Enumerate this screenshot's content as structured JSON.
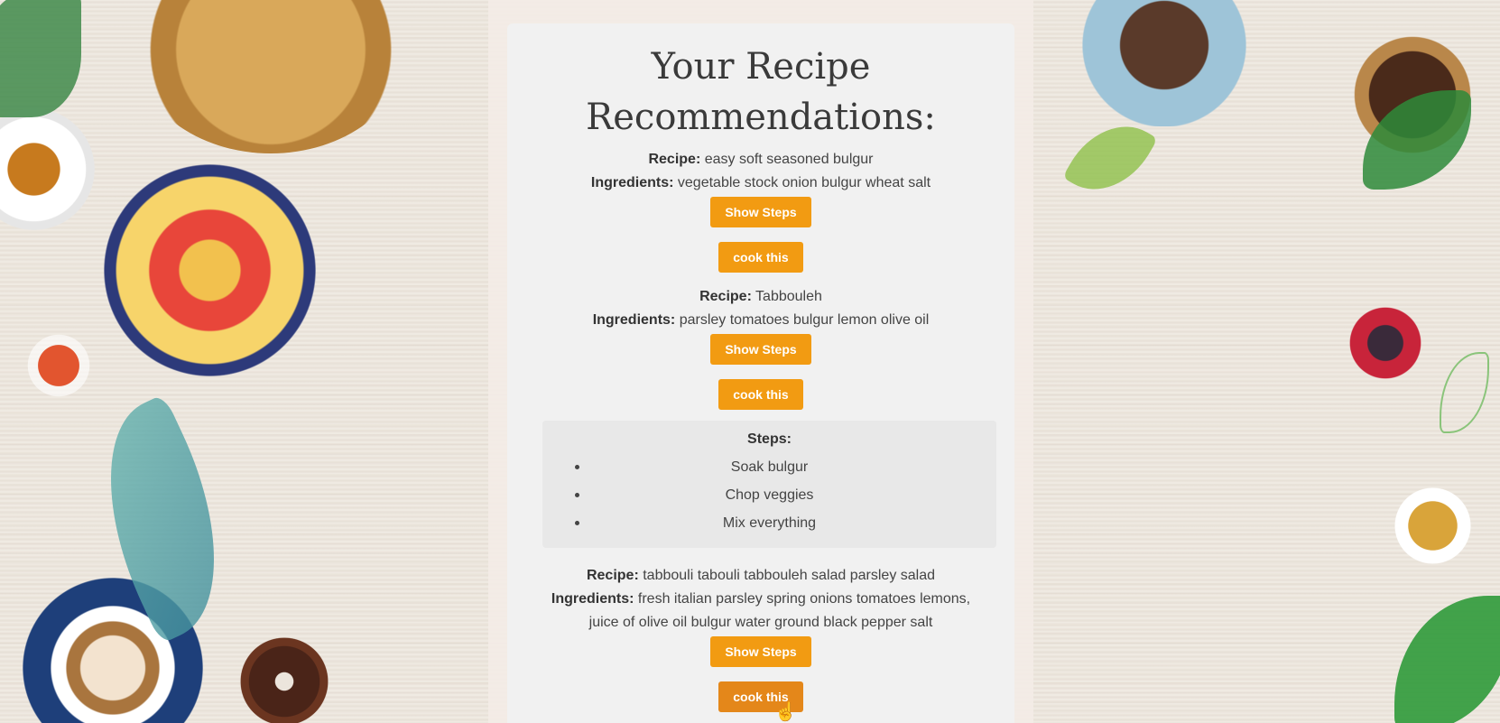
{
  "page": {
    "title": "Your Recipe Recommendations:"
  },
  "labels": {
    "recipe": "Recipe:",
    "ingredients": "Ingredients:",
    "show_steps": "Show Steps",
    "cook_this": "cook this",
    "steps": "Steps:"
  },
  "recipes": [
    {
      "name": "easy soft seasoned bulgur",
      "ingredients": "vegetable stock onion bulgur wheat salt"
    },
    {
      "name": "Tabbouleh",
      "ingredients": "parsley tomatoes bulgur lemon olive oil",
      "steps": [
        "Soak bulgur",
        "Chop veggies",
        "Mix everything"
      ]
    },
    {
      "name": "tabbouli tabouli tabbouleh salad parsley salad",
      "ingredients_line1": "fresh italian parsley spring onions tomatoes lemons,",
      "ingredients_line2": "juice of olive oil bulgur water ground black pepper salt"
    }
  ],
  "colors": {
    "button": "#f29b12",
    "button_active": "#e4871a",
    "card": "#f1f1f1",
    "steps_box": "#e8e8e8"
  }
}
